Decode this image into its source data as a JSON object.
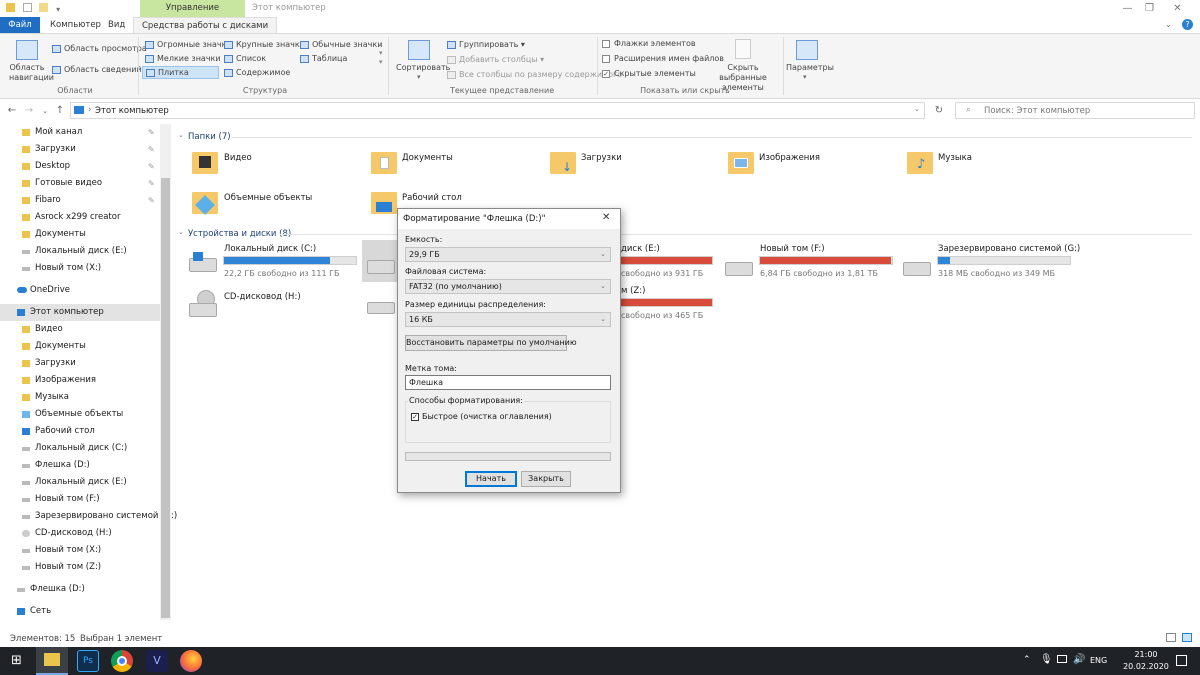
{
  "window": {
    "title": "Этот компьютер",
    "context_tab": "Управление",
    "controls": {
      "minimize": "—",
      "maximize": "❐",
      "close": "✕"
    }
  },
  "ribbon_tabs": {
    "file": "Файл",
    "computer": "Компьютер",
    "view": "Вид",
    "manage": "Средства работы с дисками"
  },
  "ribbon": {
    "panes": {
      "nav_pane": "Область навигации",
      "preview": "Область просмотра",
      "details": "Область сведений",
      "group": "Области"
    },
    "layout": {
      "huge": "Огромные значки",
      "large": "Крупные значки",
      "normal": "Обычные значки",
      "small": "Мелкие значки",
      "list": "Список",
      "table": "Таблица",
      "tiles": "Плитка",
      "content": "Содержимое",
      "group": "Структура"
    },
    "current_view": {
      "sort": "Сортировать",
      "group_by": "Группировать",
      "add_columns": "Добавить столбцы",
      "fit_columns": "Все столбцы по размеру содержимого",
      "group": "Текущее представление"
    },
    "show_hide": {
      "checkboxes": "Флажки элементов",
      "extensions": "Расширения имен файлов",
      "hidden": "Скрытые элементы",
      "hide_selected": "Скрыть выбранные элементы",
      "group": "Показать или скрыть"
    },
    "options": "Параметры"
  },
  "address": {
    "path": "Этот компьютер",
    "search_placeholder": "Поиск: Этот компьютер"
  },
  "nav": {
    "quick": [
      {
        "label": "Мой канал"
      },
      {
        "label": "Загрузки"
      },
      {
        "label": "Desktop"
      },
      {
        "label": "Готовые видео"
      },
      {
        "label": "Fibaro"
      },
      {
        "label": "Asrock x299 creator"
      },
      {
        "label": "Документы"
      },
      {
        "label": "Локальный диск (E:)"
      },
      {
        "label": "Новый том (X:)"
      }
    ],
    "onedrive": "OneDrive",
    "this_pc": "Этот компьютер",
    "pc_items": [
      {
        "label": "Видео"
      },
      {
        "label": "Документы"
      },
      {
        "label": "Загрузки"
      },
      {
        "label": "Изображения"
      },
      {
        "label": "Музыка"
      },
      {
        "label": "Объемные объекты"
      },
      {
        "label": "Рабочий стол"
      },
      {
        "label": "Локальный диск (C:)"
      },
      {
        "label": "Флешка (D:)"
      },
      {
        "label": "Локальный диск (E:)"
      },
      {
        "label": "Новый том (F:)"
      },
      {
        "label": "Зарезервировано системой (G:)"
      },
      {
        "label": "CD-дисковод (H:)"
      },
      {
        "label": "Новый том (X:)"
      },
      {
        "label": "Новый том (Z:)"
      }
    ],
    "flash": "Флешка (D:)",
    "network": "Сеть"
  },
  "content": {
    "folders_header": "Папки (7)",
    "folders": [
      {
        "name": "Видео"
      },
      {
        "name": "Документы"
      },
      {
        "name": "Загрузки"
      },
      {
        "name": "Изображения"
      },
      {
        "name": "Музыка"
      },
      {
        "name": "Объемные объекты"
      },
      {
        "name": "Рабочий стол"
      }
    ],
    "drives_header": "Устройства и диски (8)",
    "drives": {
      "c": {
        "name": "Локальный диск (C:)",
        "free": "22,2 ГБ свободно из 111 ГБ",
        "used_fraction": 0.8
      },
      "e": {
        "name": "диск (E:)",
        "free": "свободно из 931 ГБ",
        "used_fraction": 1.0
      },
      "f": {
        "name": "Новый том (F:)",
        "free": "6,84 ГБ свободно из 1,81 ТБ",
        "used_fraction": 0.99
      },
      "g": {
        "name": "Зарезервировано системой (G:)",
        "free": "318 МБ свободно из 349 МБ",
        "used_fraction": 0.09
      },
      "h": {
        "name": "CD-дисковод (H:)"
      },
      "z": {
        "name": "м (Z:)",
        "free": "свободно из 465 ГБ",
        "used_fraction": 1.0
      }
    }
  },
  "status": {
    "count": "Элементов: 15",
    "selected": "Выбран 1 элемент"
  },
  "taskbar": {
    "lang": "ENG",
    "time": "21:00",
    "date": "20.02.2020"
  },
  "dialog": {
    "title": "Форматирование \"Флешка (D:)\"",
    "capacity_label": "Емкость:",
    "capacity_value": "29,9 ГБ",
    "fs_label": "Файловая система:",
    "fs_value": "FAT32 (по умолчанию)",
    "alloc_label": "Размер единицы распределения:",
    "alloc_value": "16 КБ",
    "restore_button": "Восстановить параметры по умолчанию",
    "volume_label": "Метка тома:",
    "volume_value": "Флешка",
    "options_label": "Способы форматирования:",
    "quick_label": "Быстрое (очистка оглавления)",
    "quick_checked": "✓",
    "start_button": "Начать",
    "close_button": "Закрыть"
  },
  "colors": {
    "accent": "#1f6ec4",
    "bar_normal": "#2f86d8",
    "bar_full": "#d94b3b",
    "context_tab": "#c8e6a0"
  }
}
